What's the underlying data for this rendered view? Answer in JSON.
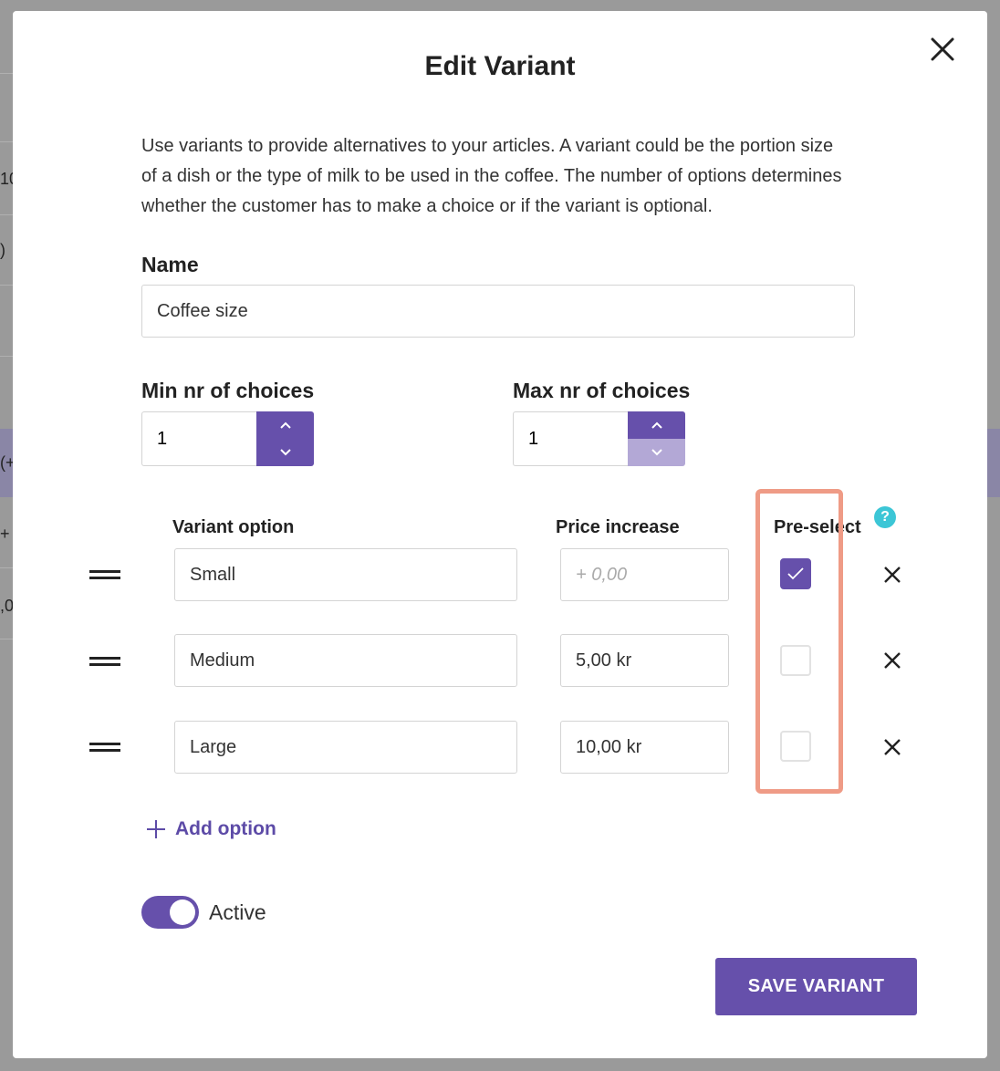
{
  "background": {
    "fragments": [
      "10",
      ")",
      "(+",
      "+",
      ",0"
    ]
  },
  "modal": {
    "title": "Edit Variant",
    "intro": "Use variants to provide alternatives to your articles. A variant could be the portion size of a dish or the type of milk to be used in the coffee. The number of options determines whether the customer has to make a choice or if the variant is optional.",
    "name_label": "Name",
    "name_value": "Coffee size",
    "min_label": "Min nr of choices",
    "min_value": "1",
    "max_label": "Max nr of choices",
    "max_value": "1",
    "columns": {
      "option": "Variant option",
      "price": "Price increase",
      "preselect": "Pre-select"
    },
    "help_glyph": "?",
    "options": [
      {
        "name": "Small",
        "price": "",
        "price_placeholder": "+ 0,00",
        "preselected": true
      },
      {
        "name": "Medium",
        "price": "5,00 kr",
        "price_placeholder": "+ 0,00",
        "preselected": false
      },
      {
        "name": "Large",
        "price": "10,00 kr",
        "price_placeholder": "+ 0,00",
        "preselected": false
      }
    ],
    "add_option_label": "Add option",
    "active_label": "Active",
    "active": true,
    "save_label": "SAVE VARIANT"
  },
  "colors": {
    "accent": "#6650ab",
    "accent_disabled": "#b3a8d6",
    "help": "#3cc6d6",
    "highlight": "#ef9b86"
  },
  "icons": [
    "close-icon",
    "chevron-up-icon",
    "chevron-down-icon",
    "help-icon",
    "drag-handle-icon",
    "checkmark-icon",
    "remove-icon",
    "plus-icon"
  ]
}
